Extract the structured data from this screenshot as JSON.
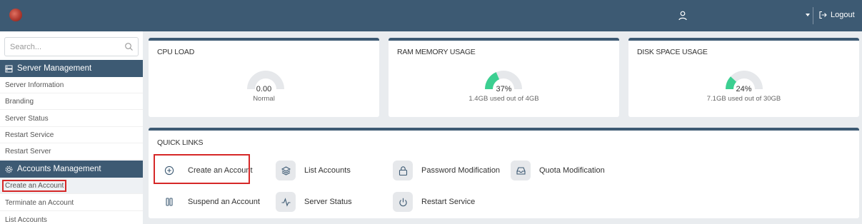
{
  "header": {
    "logout_label": "Logout"
  },
  "sidebar": {
    "search_placeholder": "Search...",
    "sections": [
      {
        "title": "Server Management",
        "items": [
          "Server Information",
          "Branding",
          "Server Status",
          "Restart Service",
          "Restart Server"
        ]
      },
      {
        "title": "Accounts Management",
        "items": [
          "Create an Account",
          "Terminate an Account",
          "List Accounts"
        ]
      }
    ]
  },
  "stats": {
    "cpu": {
      "title": "CPU LOAD",
      "value": "0.00",
      "sub": "Normal",
      "fraction": 0.0
    },
    "ram": {
      "title": "RAM MEMORY USAGE",
      "value": "37%",
      "sub": "1.4GB used out of 4GB",
      "fraction": 0.37
    },
    "disk": {
      "title": "DISK SPACE USAGE",
      "value": "24%",
      "sub": "7.1GB used out of 30GB",
      "fraction": 0.24
    }
  },
  "quick_links": {
    "title": "QUICK LINKS",
    "items": [
      {
        "label": "Create an Account",
        "icon": "plus-circle-icon"
      },
      {
        "label": "List Accounts",
        "icon": "layers-icon"
      },
      {
        "label": "Password Modification",
        "icon": "lock-icon"
      },
      {
        "label": "Quota Modification",
        "icon": "inbox-icon"
      },
      {
        "label": "Suspend an Account",
        "icon": "pause-icon"
      },
      {
        "label": "Server Status",
        "icon": "activity-icon"
      },
      {
        "label": "Restart Service",
        "icon": "power-icon"
      }
    ]
  },
  "colors": {
    "primary": "#3d5a73",
    "gauge_fill": "#3ccf91",
    "gauge_track": "#e6e8eb",
    "highlight": "#d62828"
  }
}
